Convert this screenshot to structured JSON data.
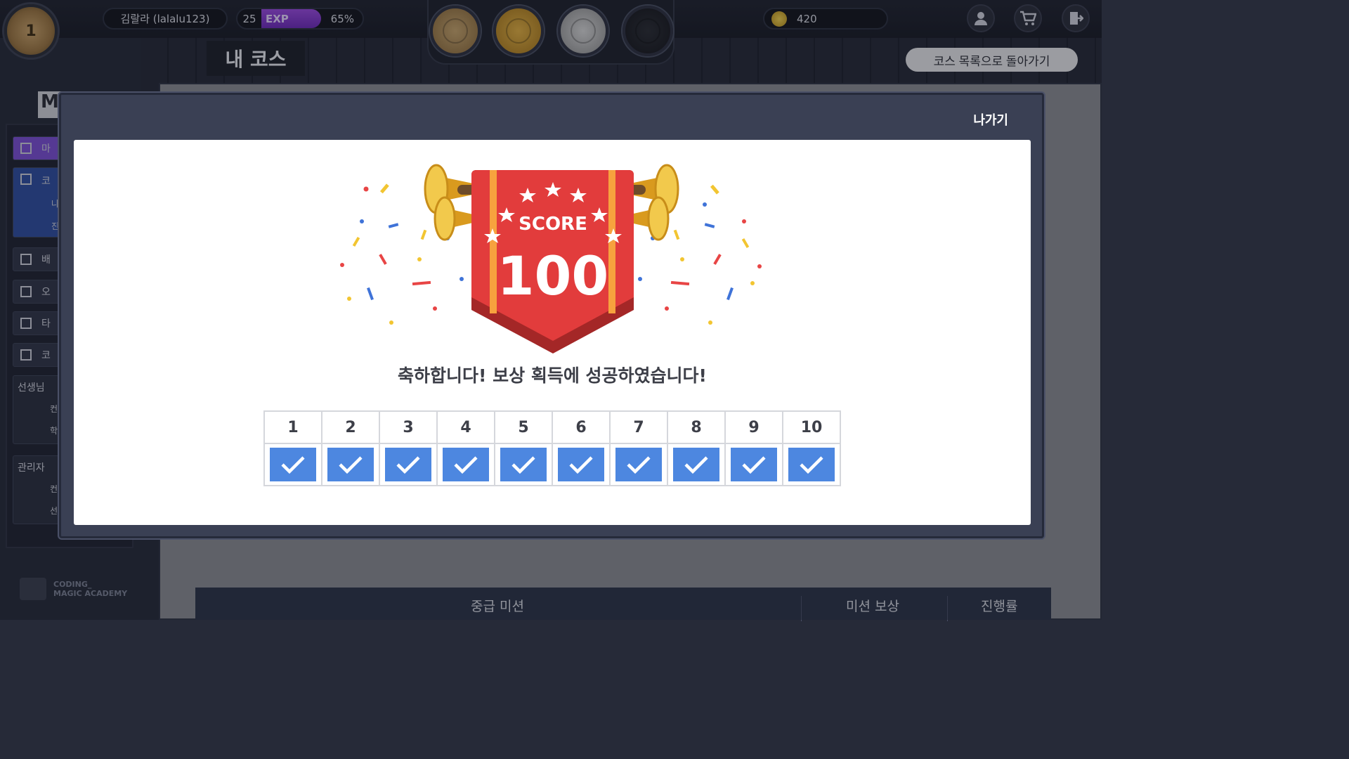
{
  "header": {
    "rank_medal_value": "1",
    "user_label": "김랄라 (lalalu123)",
    "level": "25",
    "exp_label": "EXP",
    "exp_percent_text": "65%",
    "exp_progress": 0.65,
    "medals": [
      "ranking-medal",
      "gold-medal",
      "silver-medal",
      "dark-trophy-medal"
    ],
    "coins": "420",
    "icons": [
      "user-icon",
      "cart-icon",
      "exit-door-icon"
    ]
  },
  "page": {
    "title": "내 코스",
    "back_button": "코스 목록으로 돌아가기"
  },
  "sidebar": {
    "letter": "M",
    "items": [
      {
        "label": "마",
        "icon": "wand-icon"
      },
      {
        "label": "코",
        "icon": "grid-icon",
        "sub": [
          "나",
          "진"
        ]
      },
      {
        "label": "배",
        "icon": "copy-icon"
      },
      {
        "label": "오",
        "icon": "image-icon"
      },
      {
        "label": "타",
        "icon": "text-icon"
      },
      {
        "label": "코",
        "icon": "window-icon"
      }
    ],
    "teacher_group": {
      "title": "선생님",
      "sub": [
        "컨",
        "학"
      ]
    },
    "admin_group": {
      "title": "관리자",
      "sub": [
        "컨",
        "선"
      ]
    },
    "logo_line1": "CODING_",
    "logo_line2": "MAGIC ACADEMY"
  },
  "background_table": {
    "col1": "중급 미션",
    "col2": "미션 보상",
    "col3": "진행률"
  },
  "modal": {
    "exit_button": "나가기",
    "score_label": "SCORE",
    "score_value": "100",
    "message": "축하합니다! 보상 획득에 성공하였습니다!",
    "missions": [
      {
        "number": "1",
        "completed": true
      },
      {
        "number": "2",
        "completed": true
      },
      {
        "number": "3",
        "completed": true
      },
      {
        "number": "4",
        "completed": true
      },
      {
        "number": "5",
        "completed": true
      },
      {
        "number": "6",
        "completed": true
      },
      {
        "number": "7",
        "completed": true
      },
      {
        "number": "8",
        "completed": true
      },
      {
        "number": "9",
        "completed": true
      },
      {
        "number": "10",
        "completed": true
      }
    ]
  },
  "colors": {
    "accent_purple": "#7b4fd4",
    "check_blue": "#4d87e0",
    "banner_red": "#e23c3c",
    "banner_stripe": "#f7a23e"
  }
}
